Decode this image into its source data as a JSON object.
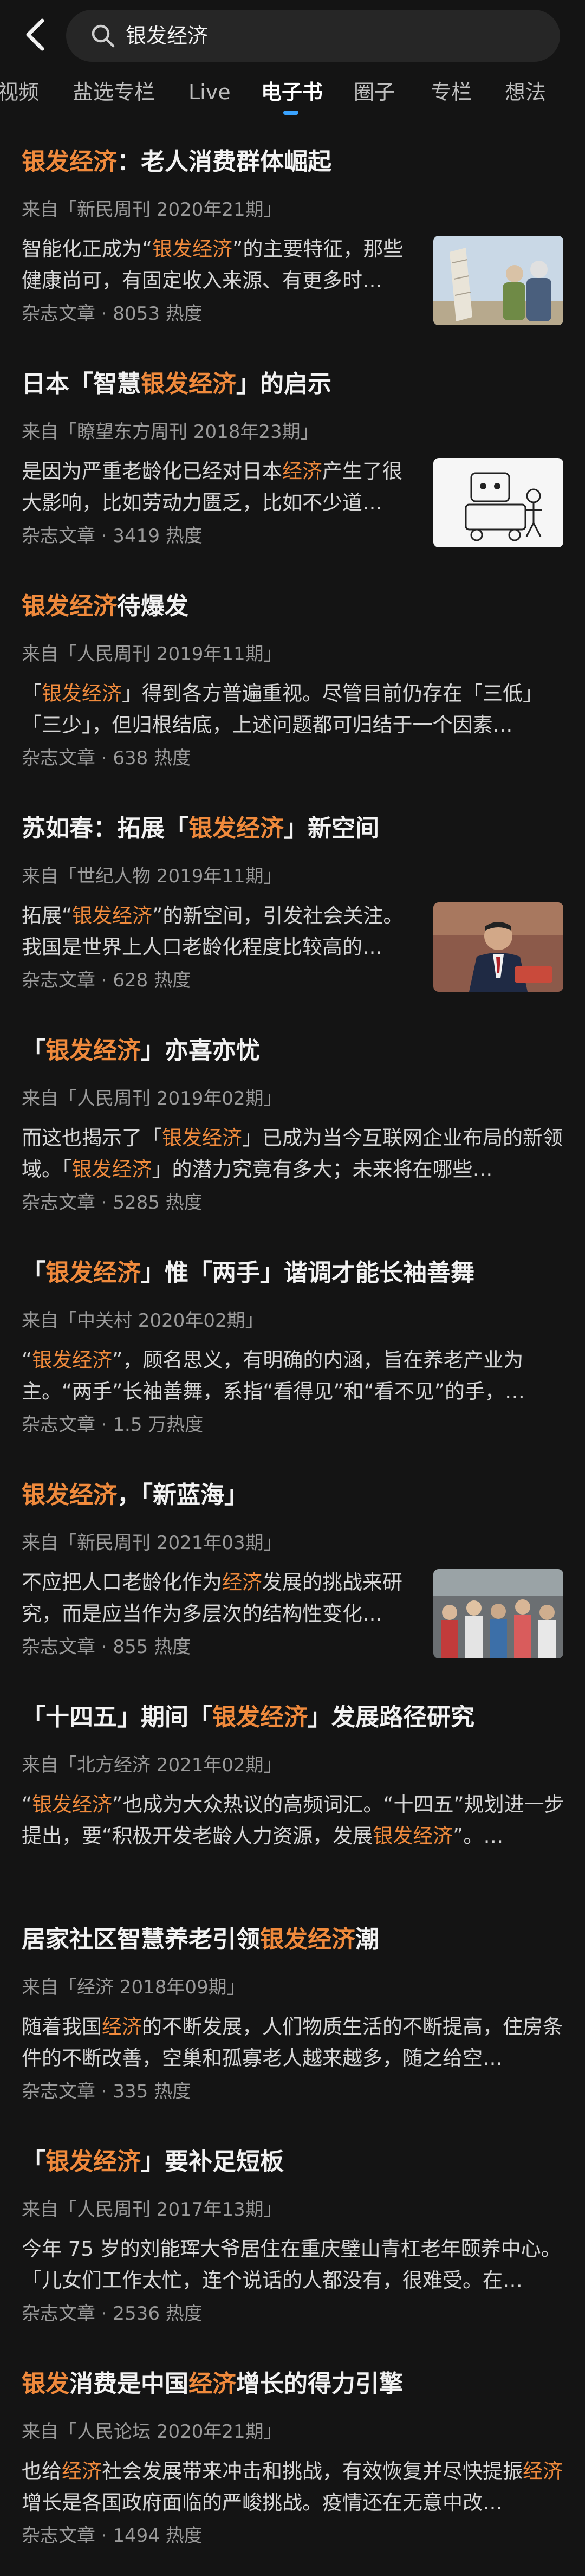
{
  "search": {
    "query": "银发经济"
  },
  "tabs": [
    {
      "label": "视频"
    },
    {
      "label": "盐选专栏"
    },
    {
      "label": "Live"
    },
    {
      "label": "电子书"
    },
    {
      "label": "圈子"
    },
    {
      "label": "专栏"
    },
    {
      "label": "想法"
    }
  ],
  "colors": {
    "background": "#000000",
    "card": "#141414",
    "highlight": "#f08a3c",
    "active_tab_indicator": "#3aa3ff"
  },
  "results": [
    {
      "title": [
        {
          "t": "银发经济",
          "h": true
        },
        {
          "t": "：老人消费群体崛起",
          "h": false
        }
      ],
      "source": "来自「新民周刊 2020年21期」",
      "snippet": [
        {
          "t": "智能化正成为“",
          "h": false
        },
        {
          "t": "银发经济",
          "h": true
        },
        {
          "t": "”的主要特征，那些健康尚可，有固定收入来源、有更多时…",
          "h": false
        }
      ],
      "meta": "杂志文章 · 8053 热度",
      "thumbnail": "elderly-couple-photo"
    },
    {
      "title": [
        {
          "t": "日本「智慧",
          "h": false
        },
        {
          "t": "银发经济",
          "h": true
        },
        {
          "t": "」的启示",
          "h": false
        }
      ],
      "source": "来自「瞭望东方周刊 2018年23期」",
      "snippet": [
        {
          "t": "是因为严重老龄化已经对日本",
          "h": false
        },
        {
          "t": "经济",
          "h": true
        },
        {
          "t": "产生了很大影响，比如劳动力匮乏，比如不少道…",
          "h": false
        }
      ],
      "meta": "杂志文章 · 3419 热度",
      "thumbnail": "robot-illustration"
    },
    {
      "title": [
        {
          "t": "银发经济",
          "h": true
        },
        {
          "t": "待爆发",
          "h": false
        }
      ],
      "source": "来自「人民周刊 2019年11期」",
      "snippet": [
        {
          "t": "「",
          "h": false
        },
        {
          "t": "银发经济",
          "h": true
        },
        {
          "t": "」得到各方普遍重视。尽管目前仍存在「三低」「三少」，但归根结底，上述问题都可归结于一个因素…",
          "h": false
        }
      ],
      "meta": "杂志文章 · 638 热度",
      "thumbnail": ""
    },
    {
      "title": [
        {
          "t": "苏如春：拓展「",
          "h": false
        },
        {
          "t": "银发经济",
          "h": true
        },
        {
          "t": "」新空间",
          "h": false
        }
      ],
      "source": "来自「世纪人物 2019年11期」",
      "snippet": [
        {
          "t": "拓展“",
          "h": false
        },
        {
          "t": "银发经济",
          "h": true
        },
        {
          "t": "”的新空间，引发社会关注。我国是世界上人口老龄化程度比较高的…",
          "h": false
        }
      ],
      "meta": "杂志文章 · 628 热度",
      "thumbnail": "man-speaking-photo"
    },
    {
      "title": [
        {
          "t": "「",
          "h": false
        },
        {
          "t": "银发经济",
          "h": true
        },
        {
          "t": "」亦喜亦忧",
          "h": false
        }
      ],
      "source": "来自「人民周刊 2019年02期」",
      "snippet": [
        {
          "t": "而这也揭示了「",
          "h": false
        },
        {
          "t": "银发经济",
          "h": true
        },
        {
          "t": "」已成为当今互联网企业布局的新领域。「",
          "h": false
        },
        {
          "t": "银发经济",
          "h": true
        },
        {
          "t": "」的潜力究竟有多大；未来将在哪些…",
          "h": false
        }
      ],
      "meta": "杂志文章 · 5285 热度",
      "thumbnail": ""
    },
    {
      "title": [
        {
          "t": "「",
          "h": false
        },
        {
          "t": "银发经济",
          "h": true
        },
        {
          "t": "」惟「两手」谐调才能长袖善舞",
          "h": false
        }
      ],
      "source": "来自「中关村 2020年02期」",
      "snippet": [
        {
          "t": "“",
          "h": false
        },
        {
          "t": "银发经济",
          "h": true
        },
        {
          "t": "”，顾名思义，有明确的内涵，旨在养老产业为主。“两手”长袖善舞，系指“看得见”和“看不见”的手，…",
          "h": false
        }
      ],
      "meta": "杂志文章 · 1.5 万热度",
      "thumbnail": ""
    },
    {
      "title": [
        {
          "t": "银发经济",
          "h": true
        },
        {
          "t": "，「新蓝海」",
          "h": false
        }
      ],
      "source": "来自「新民周刊 2021年03期」",
      "snippet": [
        {
          "t": "不应把人口老龄化作为",
          "h": false
        },
        {
          "t": "经济",
          "h": true
        },
        {
          "t": "发展的挑战来研究，而是应当作为多层次的结构性变化…",
          "h": false
        }
      ],
      "meta": "杂志文章 · 855 热度",
      "thumbnail": "crowd-photo"
    },
    {
      "title": [
        {
          "t": "「十四五」期间「",
          "h": false
        },
        {
          "t": "银发经济",
          "h": true
        },
        {
          "t": "」发展路径研究",
          "h": false
        }
      ],
      "source": "来自「北方经济 2021年02期」",
      "snippet": [
        {
          "t": "“",
          "h": false
        },
        {
          "t": "银发经济",
          "h": true
        },
        {
          "t": "”也成为大众热议的高频词汇。“十四五”规划进一步提出，要“积极开发老龄人力资源，发展",
          "h": false
        },
        {
          "t": "银发经济",
          "h": true
        },
        {
          "t": "”。…",
          "h": false
        }
      ],
      "meta": "",
      "thumbnail": ""
    },
    {
      "title": [
        {
          "t": "居家社区智慧养老引领",
          "h": false
        },
        {
          "t": "银发经济",
          "h": true
        },
        {
          "t": "潮",
          "h": false
        }
      ],
      "source": "来自「经济 2018年09期」",
      "snippet": [
        {
          "t": "随着我国",
          "h": false
        },
        {
          "t": "经济",
          "h": true
        },
        {
          "t": "的不断发展，人们物质生活的不断提高，住房条件的不断改善，空巢和孤寡老人越来越多，随之给空…",
          "h": false
        }
      ],
      "meta": "杂志文章 · 335 热度",
      "thumbnail": ""
    },
    {
      "title": [
        {
          "t": "「",
          "h": false
        },
        {
          "t": "银发经济",
          "h": true
        },
        {
          "t": "」要补足短板",
          "h": false
        }
      ],
      "source": "来自「人民周刊 2017年13期」",
      "snippet": [
        {
          "t": "今年 75 岁的刘能珲大爷居住在重庆璧山青杠老年颐养中心。「儿女们工作太忙，连个说话的人都没有，很难受。在…",
          "h": false
        }
      ],
      "meta": "杂志文章 · 2536 热度",
      "thumbnail": ""
    },
    {
      "title": [
        {
          "t": "银发",
          "h": true
        },
        {
          "t": "消费是中国",
          "h": false
        },
        {
          "t": "经济",
          "h": true
        },
        {
          "t": "增长的得力引擎",
          "h": false
        }
      ],
      "source": "来自「人民论坛 2020年21期」",
      "snippet": [
        {
          "t": "也给",
          "h": false
        },
        {
          "t": "经济",
          "h": true
        },
        {
          "t": "社会发展带来冲击和挑战，有效恢复并尽快提振",
          "h": false
        },
        {
          "t": "经济",
          "h": true
        },
        {
          "t": "增长是各国政府面临的严峻挑战。疫情还在无意中改…",
          "h": false
        }
      ],
      "meta": "杂志文章 · 1494 热度",
      "thumbnail": ""
    }
  ]
}
